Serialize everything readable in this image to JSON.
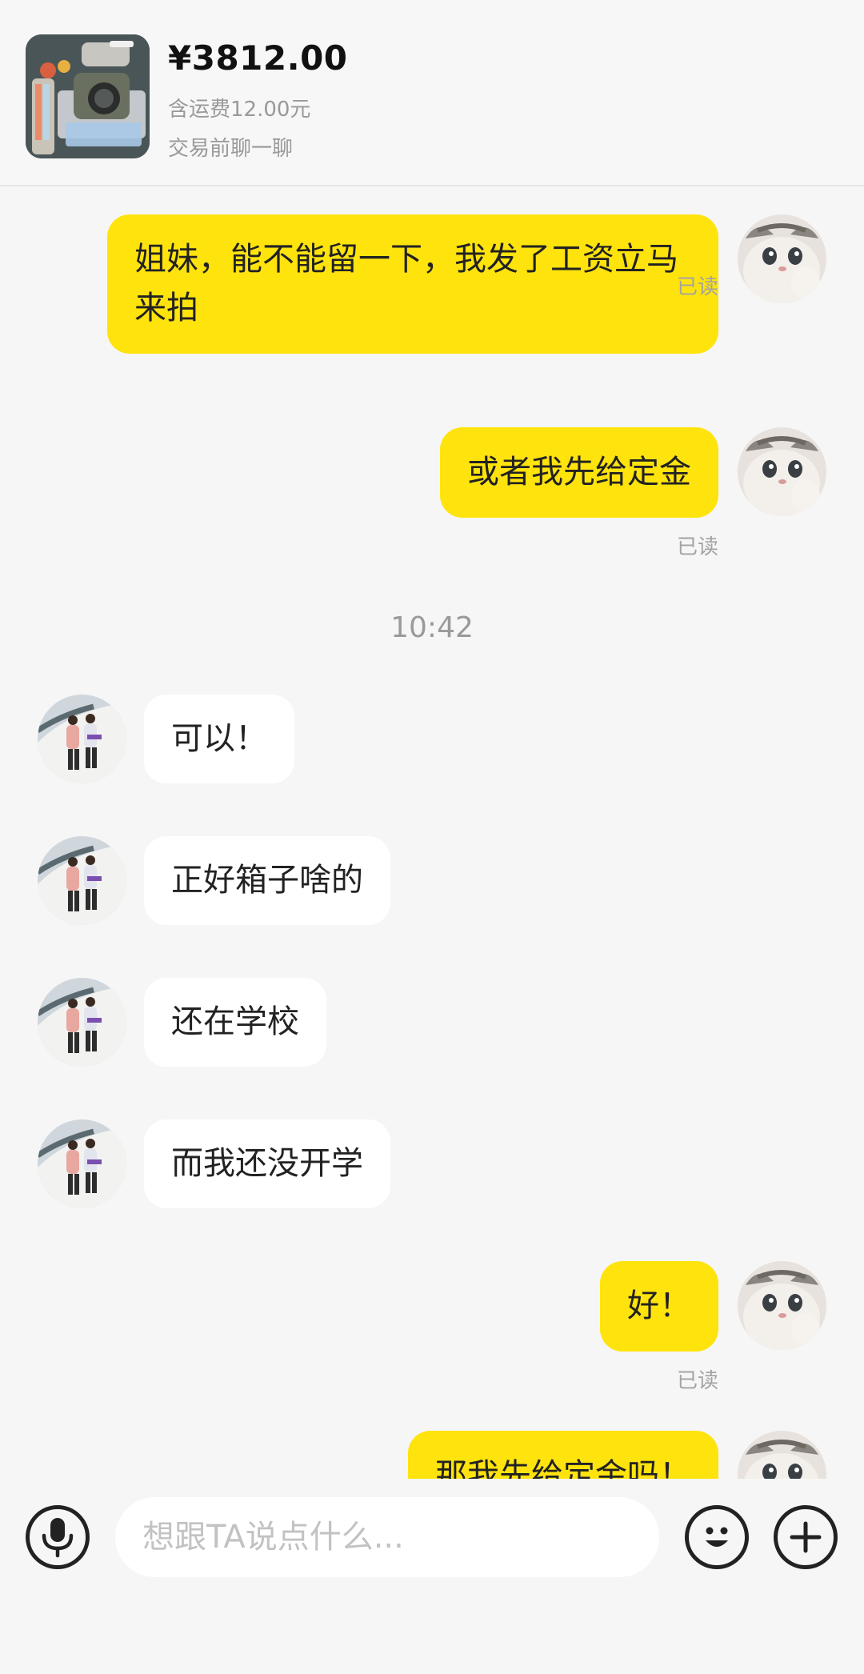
{
  "product": {
    "price": "¥3812.00",
    "shipping": "含运费12.00元",
    "chat_note": "交易前聊一聊"
  },
  "messages": [
    {
      "from": "me",
      "text": "姐妹，能不能留一下，我发了工资立马来拍",
      "read": "已读"
    },
    {
      "from": "me",
      "text": "或者我先给定金",
      "read": "已读"
    },
    {
      "type": "time",
      "text": "10:42"
    },
    {
      "from": "other",
      "text": "可以！"
    },
    {
      "from": "other",
      "text": "正好箱子啥的"
    },
    {
      "from": "other",
      "text": "还在学校"
    },
    {
      "from": "other",
      "text": "而我还没开学"
    },
    {
      "from": "me",
      "text": "好！",
      "read": "已读"
    },
    {
      "from": "me",
      "text": "那我先给定金吗！"
    }
  ],
  "input": {
    "placeholder": "想跟TA说点什么..."
  },
  "icons": {
    "voice": "microphone-icon",
    "emoji": "smiley-icon",
    "more": "plus-icon"
  },
  "colors": {
    "outgoing_bubble": "#ffe30d",
    "incoming_bubble": "#ffffff",
    "background": "#f6f6f6"
  }
}
